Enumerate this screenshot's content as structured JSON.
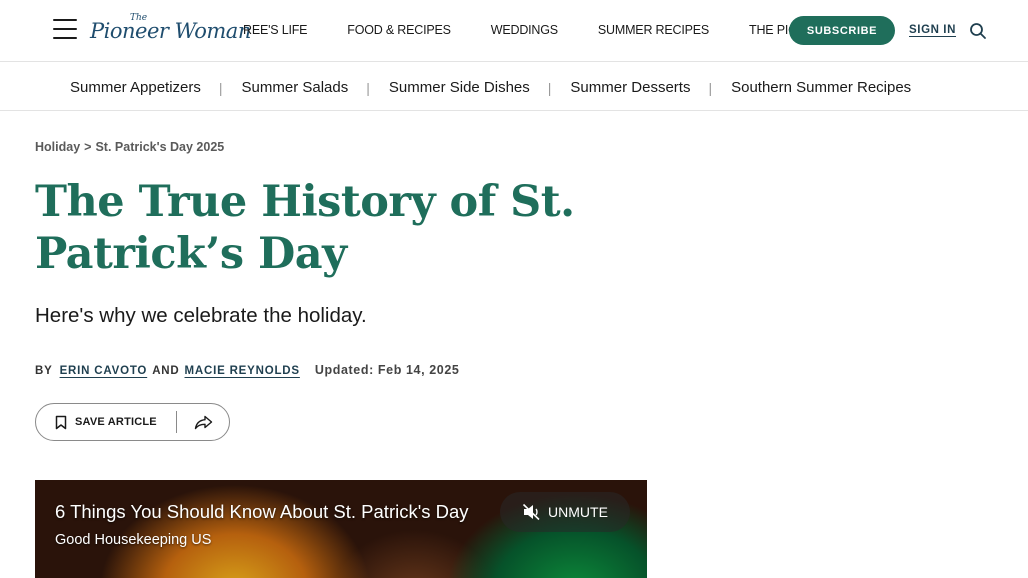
{
  "header": {
    "logo_the": "The",
    "logo_word": "Pioneer Woman",
    "nav": [
      "REE'S LIFE",
      "FOOD & RECIPES",
      "WEDDINGS",
      "SUMMER RECIPES",
      "THE PIONEER WOMAN MAGAZINE"
    ],
    "subscribe_label": "SUBSCRIBE",
    "signin_label": "SIGN IN"
  },
  "subnav": {
    "items": [
      "Summer Appetizers",
      "Summer Salads",
      "Summer Side Dishes",
      "Summer Desserts",
      "Southern Summer Recipes"
    ],
    "separator": "|"
  },
  "article": {
    "breadcrumb": [
      "Holiday",
      "St. Patrick's Day 2025"
    ],
    "breadcrumb_sep": ">",
    "title": "The True History of St. Patrick’s Day",
    "dek": "Here's why we celebrate the holiday.",
    "byline": {
      "by": "BY",
      "author1": "ERIN CAVOTO",
      "and": "AND",
      "author2": "MACIE REYNOLDS",
      "updated": "Updated: Feb 14, 2025"
    },
    "save_label": "SAVE ARTICLE"
  },
  "video": {
    "title": "6 Things You Should Know About St. Patrick's Day",
    "source": "Good Housekeeping US",
    "unmute_label": "UNMUTE"
  },
  "colors": {
    "brand_green": "#1f6e5b",
    "logo_blue": "#1f4d6e"
  }
}
